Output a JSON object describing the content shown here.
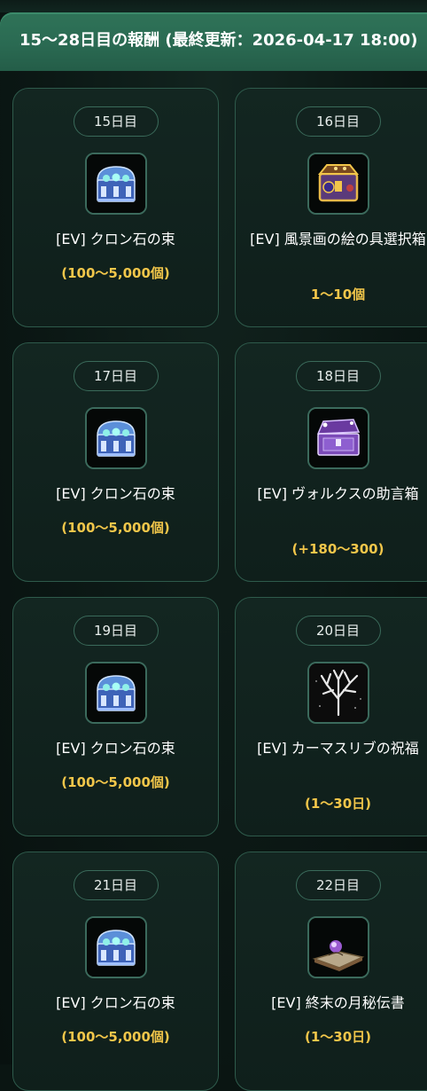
{
  "header": {
    "title": "15〜28日目の報酬 (最終更新：2026-04-17 18:00)"
  },
  "rewards": [
    {
      "day": "15日目",
      "name": "[EV] クロン石の束",
      "qty": "(100〜5,000個)",
      "icon": "blue-chest-icon"
    },
    {
      "day": "16日目",
      "name": "[EV] 風景画の絵の具選択箱",
      "qty": "1〜10個",
      "icon": "golden-box-icon"
    },
    {
      "day": "17日目",
      "name": "[EV] クロン石の束",
      "qty": "(100〜5,000個)",
      "icon": "blue-chest-icon"
    },
    {
      "day": "18日目",
      "name": "[EV] ヴォルクスの助言箱",
      "qty": "(+180〜300)",
      "icon": "purple-chest-icon"
    },
    {
      "day": "19日目",
      "name": "[EV] クロン石の束",
      "qty": "(100〜5,000個)",
      "icon": "blue-chest-icon"
    },
    {
      "day": "20日目",
      "name": "[EV] カーマスリブの祝福",
      "qty": "(1〜30日)",
      "icon": "white-tree-icon"
    },
    {
      "day": "21日目",
      "name": "[EV] クロン石の束",
      "qty": "(100〜5,000個)",
      "icon": "blue-chest-icon"
    },
    {
      "day": "22日目",
      "name": "[EV] 終末の月秘伝書",
      "qty": "(1〜30日)",
      "icon": "secret-book-icon"
    }
  ],
  "colors": {
    "header_bg": "#2a6a52",
    "card_border": "#2e5a4b",
    "qty_text": "#f2c64a",
    "page_bg": "#0a1512"
  }
}
